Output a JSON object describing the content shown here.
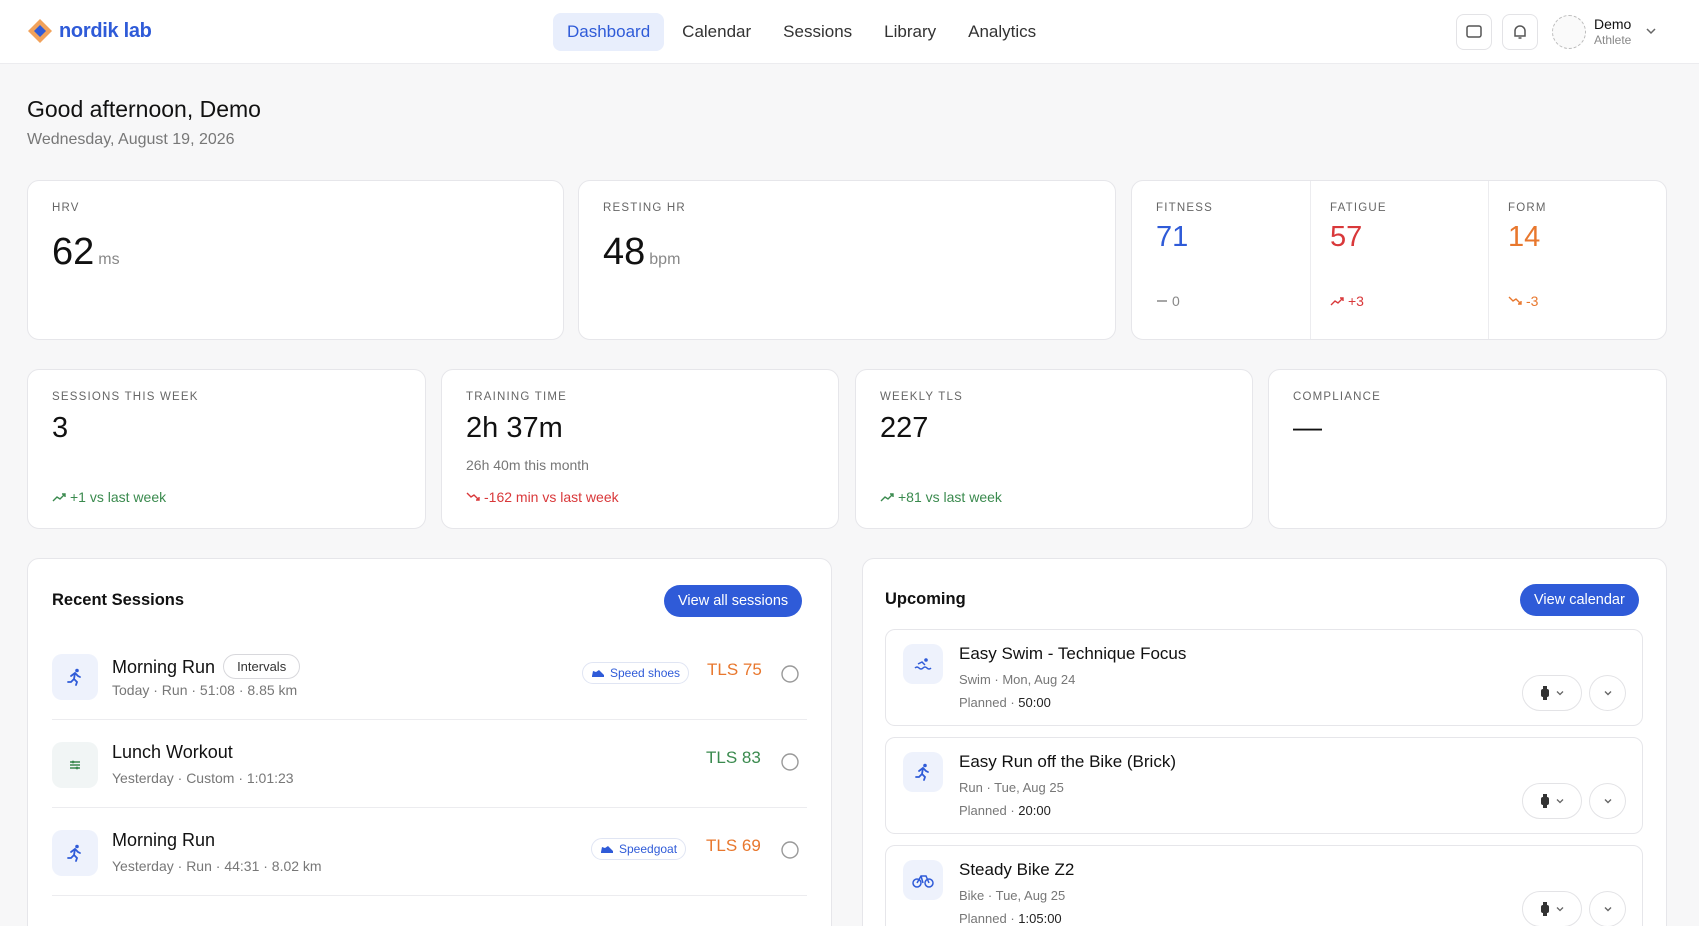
{
  "app": {
    "name": "nordik lab"
  },
  "nav": [
    {
      "label": "Dashboard",
      "active": true
    },
    {
      "label": "Calendar",
      "active": false
    },
    {
      "label": "Sessions",
      "active": false
    },
    {
      "label": "Library",
      "active": false
    },
    {
      "label": "Analytics",
      "active": false
    }
  ],
  "user": {
    "name": "Demo",
    "role": "Athlete"
  },
  "greeting": {
    "title": "Good afternoon, Demo",
    "date": "Wednesday, August 19, 2026"
  },
  "kpis": {
    "hrv": {
      "label": "HRV",
      "value": "62",
      "unit": "ms"
    },
    "resting_hr": {
      "label": "RESTING HR",
      "value": "48",
      "unit": "bpm"
    },
    "fitness": {
      "label": "FITNESS",
      "value": "71",
      "delta": "0"
    },
    "fatigue": {
      "label": "FATIGUE",
      "value": "57",
      "delta": "+3"
    },
    "form": {
      "label": "FORM",
      "value": "14",
      "delta": "-3"
    },
    "sessions_week": {
      "label": "SESSIONS THIS WEEK",
      "value": "3",
      "delta": "+1 vs last week"
    },
    "training_time": {
      "label": "TRAINING TIME",
      "value": "2h 37m",
      "sub": "26h 40m this month",
      "delta": "-162 min vs last week"
    },
    "weekly_tls": {
      "label": "WEEKLY TLS",
      "value": "227",
      "delta": "+81 vs last week"
    },
    "compliance": {
      "label": "COMPLIANCE",
      "value": "—"
    }
  },
  "recent": {
    "title": "Recent Sessions",
    "button": "View all sessions",
    "items": [
      {
        "title": "Morning Run",
        "tag": "Intervals",
        "meta": "Today  ·  Run  ·  51:08  ·  8.85 km",
        "gear": "Speed shoes",
        "tls": "TLS 75",
        "tls_color": "#e8772d"
      },
      {
        "title": "Lunch Workout",
        "meta": "Yesterday  ·  Custom  ·  1:01:23",
        "tls": "TLS 83",
        "tls_color": "#3a8a4e"
      },
      {
        "title": "Morning Run",
        "meta": "Yesterday  ·  Run  ·  44:31  ·  8.02 km",
        "gear": "Speedgoat",
        "tls": "TLS 69",
        "tls_color": "#e8772d"
      }
    ]
  },
  "upcoming": {
    "title": "Upcoming",
    "button": "View calendar",
    "planned_label": "Planned",
    "items": [
      {
        "title": "Easy Swim - Technique Focus",
        "meta": "Swim · Mon, Aug 24",
        "duration": "50:00",
        "icon": "swim-icon"
      },
      {
        "title": "Easy Run off the Bike (Brick)",
        "meta": "Run · Tue, Aug 25",
        "duration": "20:00",
        "icon": "run-icon"
      },
      {
        "title": "Steady Bike Z2",
        "meta": "Bike · Tue, Aug 25",
        "duration": "1:05:00",
        "icon": "bike-icon"
      }
    ]
  },
  "colors": {
    "accent": "#2f5bd8",
    "positive": "#3a8a4e",
    "negative": "#d9383a",
    "orange": "#e8772d"
  }
}
